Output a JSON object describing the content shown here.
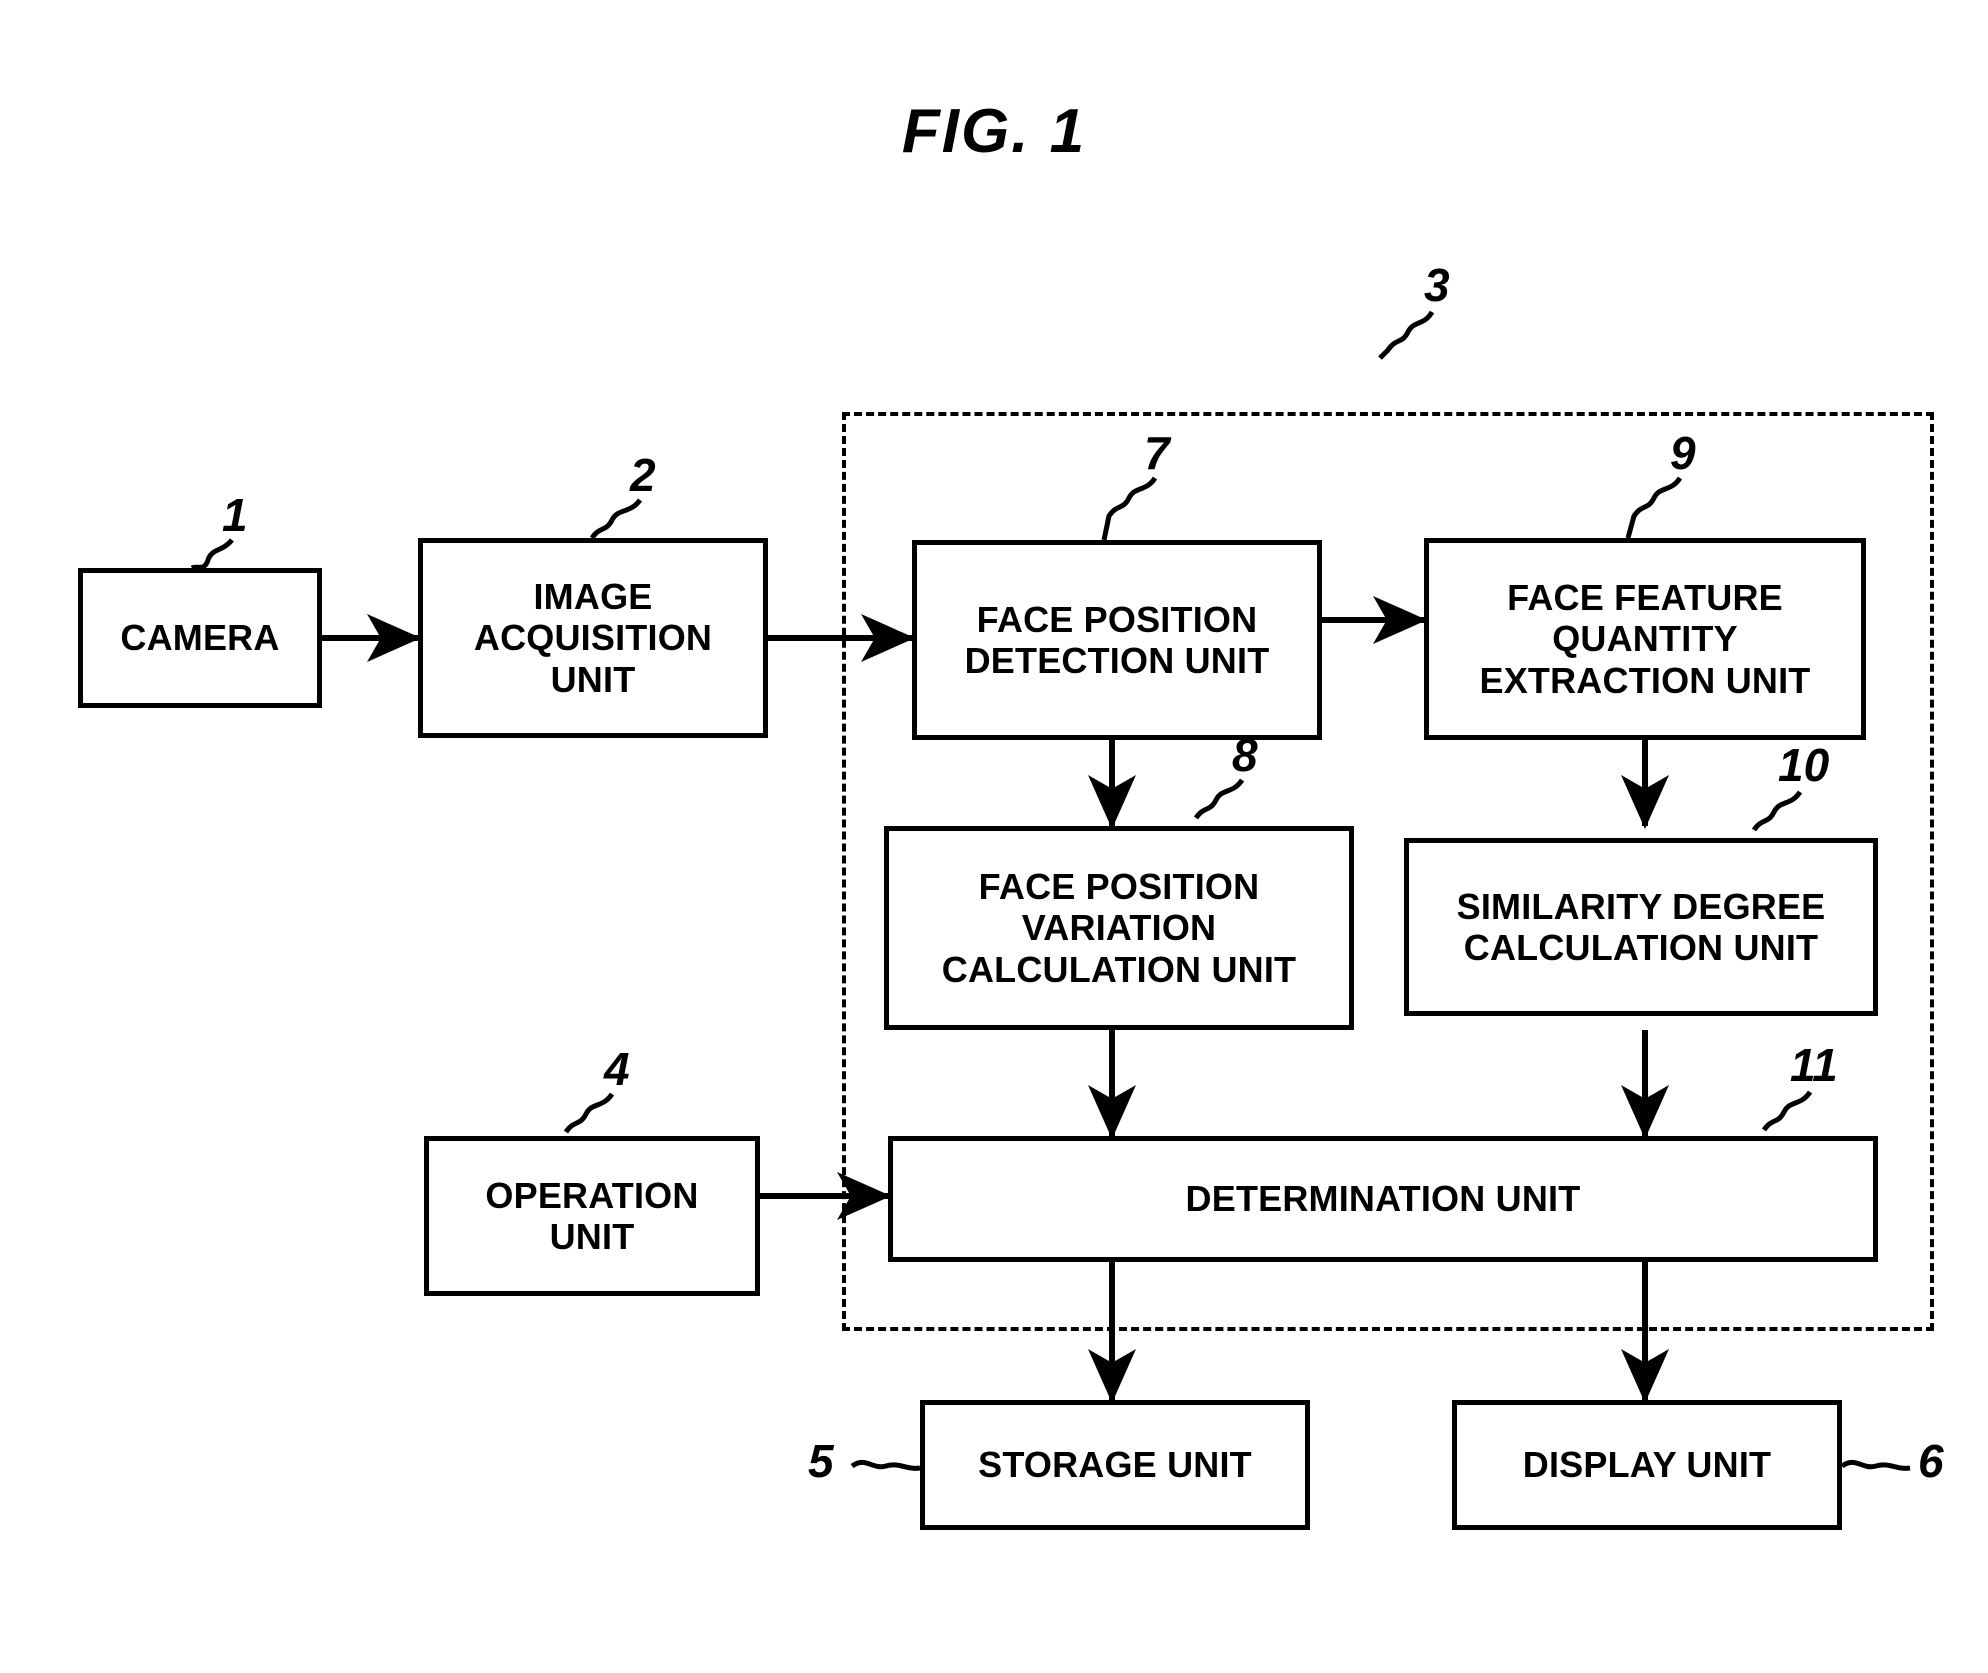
{
  "figure": {
    "title": "FIG. 1"
  },
  "diagram": {
    "type": "block-diagram",
    "boundary": {
      "ref": "3",
      "style": "dashed",
      "name": "face-recognition-apparatus-boundary"
    },
    "boxes": [
      {
        "id": "camera",
        "ref": "1",
        "label": "CAMERA"
      },
      {
        "id": "image-acquisition",
        "ref": "2",
        "label": "IMAGE\nACQUISITION\nUNIT"
      },
      {
        "id": "face-position-detection",
        "ref": "7",
        "label": "FACE POSITION\nDETECTION UNIT"
      },
      {
        "id": "face-feature-quantity-extraction",
        "ref": "9",
        "label": "FACE FEATURE\nQUANTITY\nEXTRACTION UNIT"
      },
      {
        "id": "face-position-variation-calculation",
        "ref": "8",
        "label": "FACE POSITION\nVARIATION\nCALCULATION UNIT"
      },
      {
        "id": "similarity-degree-calculation",
        "ref": "10",
        "label": "SIMILARITY DEGREE\nCALCULATION UNIT"
      },
      {
        "id": "operation",
        "ref": "4",
        "label": "OPERATION\nUNIT"
      },
      {
        "id": "determination",
        "ref": "11",
        "label": "DETERMINATION UNIT"
      },
      {
        "id": "storage",
        "ref": "5",
        "label": "STORAGE UNIT"
      },
      {
        "id": "display",
        "ref": "6",
        "label": "DISPLAY UNIT"
      }
    ],
    "connections": [
      {
        "from": "camera",
        "to": "image-acquisition",
        "arrow": "single"
      },
      {
        "from": "image-acquisition",
        "to": "face-position-detection",
        "arrow": "single"
      },
      {
        "from": "face-position-detection",
        "to": "face-feature-quantity-extraction",
        "arrow": "single"
      },
      {
        "from": "face-position-detection",
        "to": "face-position-variation-calculation",
        "arrow": "single"
      },
      {
        "from": "face-feature-quantity-extraction",
        "to": "similarity-degree-calculation",
        "arrow": "single"
      },
      {
        "from": "face-position-variation-calculation",
        "to": "determination",
        "arrow": "single"
      },
      {
        "from": "similarity-degree-calculation",
        "to": "determination",
        "arrow": "single"
      },
      {
        "from": "operation",
        "to": "determination",
        "arrow": "single"
      },
      {
        "from": "determination",
        "to": "storage",
        "arrow": "double"
      },
      {
        "from": "determination",
        "to": "display",
        "arrow": "single"
      }
    ]
  }
}
